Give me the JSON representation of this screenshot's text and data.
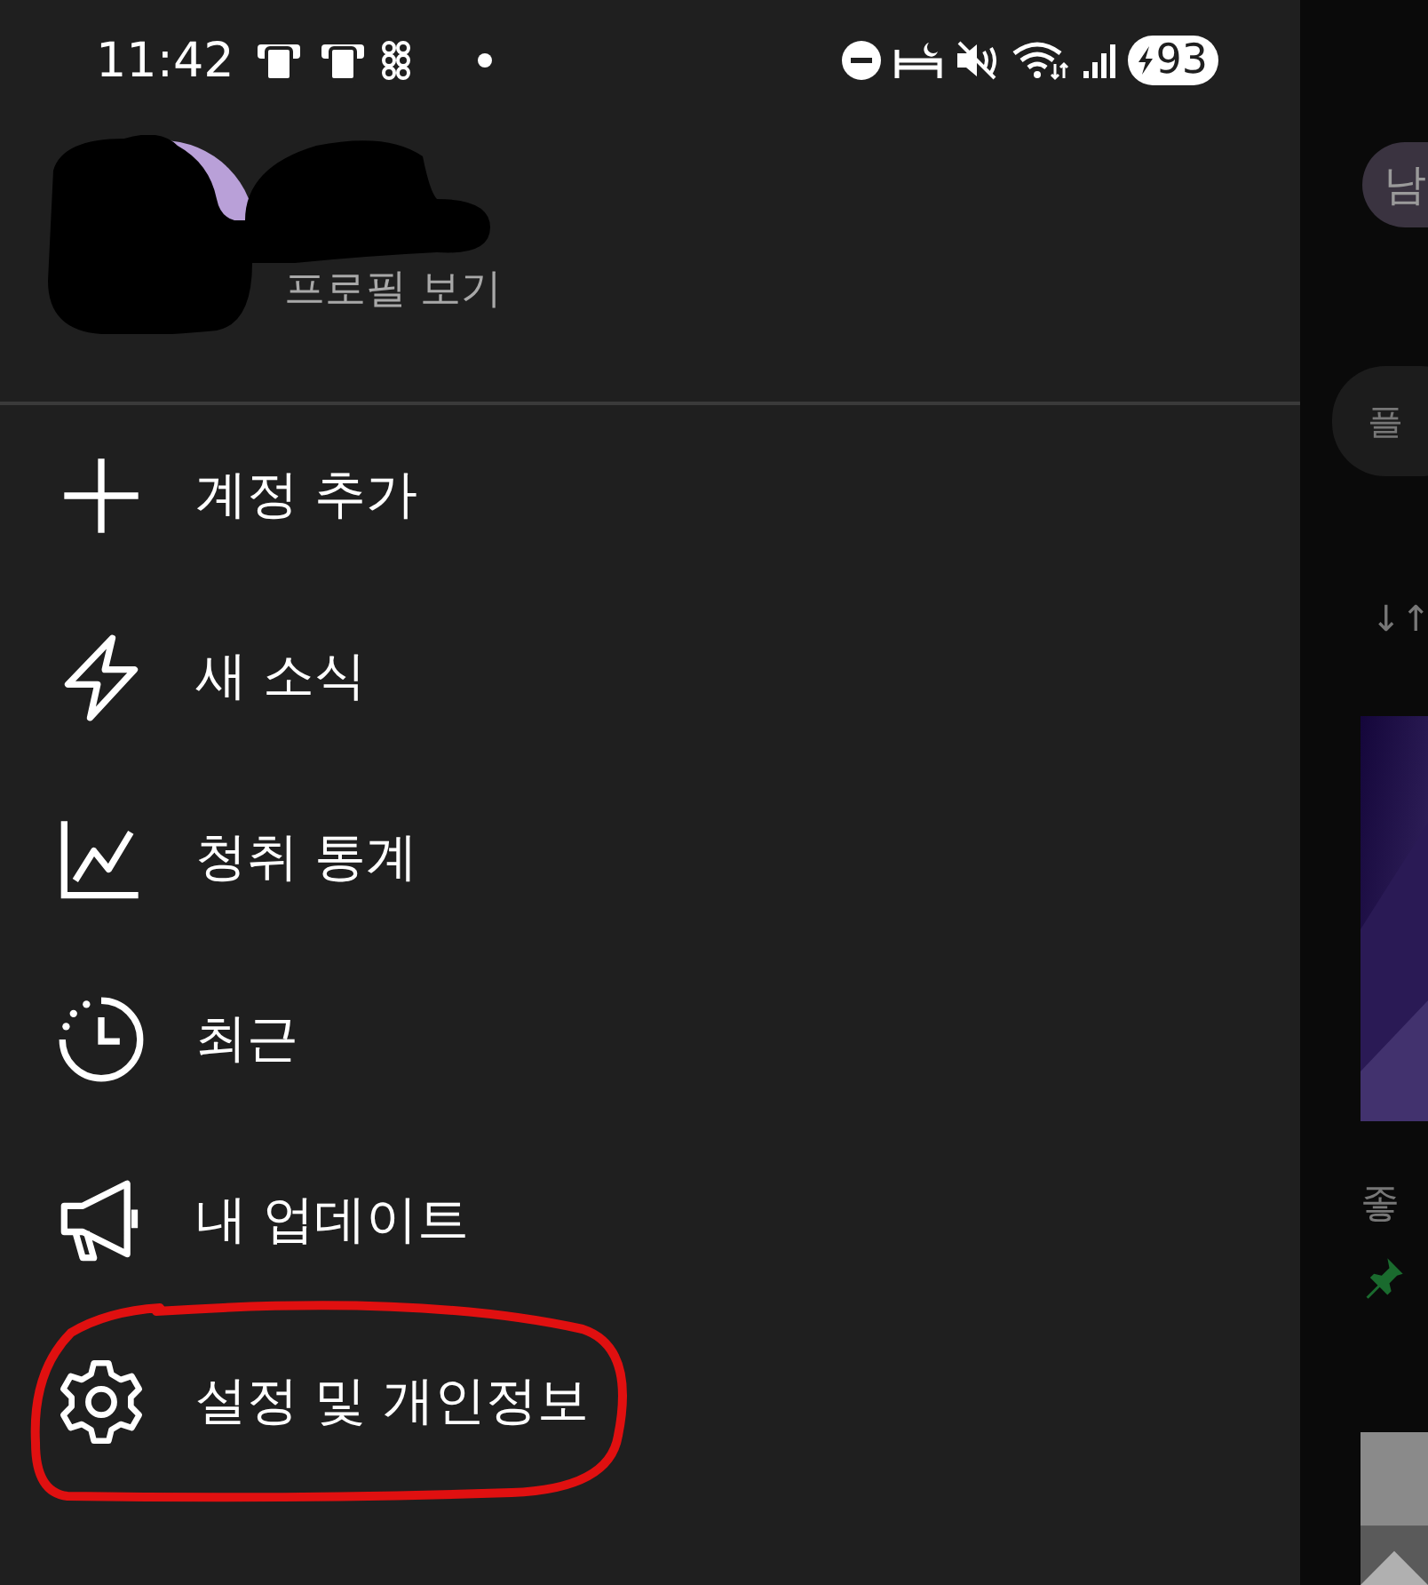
{
  "status_bar": {
    "time": "11:42",
    "battery": "93"
  },
  "profile": {
    "link": "프로필 보기"
  },
  "menu": [
    {
      "kind": "plus",
      "label": "계정 추가"
    },
    {
      "kind": "bolt",
      "label": "새 소식"
    },
    {
      "kind": "chart",
      "label": "청취 통계"
    },
    {
      "kind": "clock",
      "label": "최근"
    },
    {
      "kind": "megaphone",
      "label": "내 업데이트"
    },
    {
      "kind": "gear",
      "label": "설정 및 개인정보"
    }
  ],
  "background": {
    "avatar_letter": "남",
    "chip": "플",
    "sort": "↓↑",
    "item_title": "좋"
  }
}
